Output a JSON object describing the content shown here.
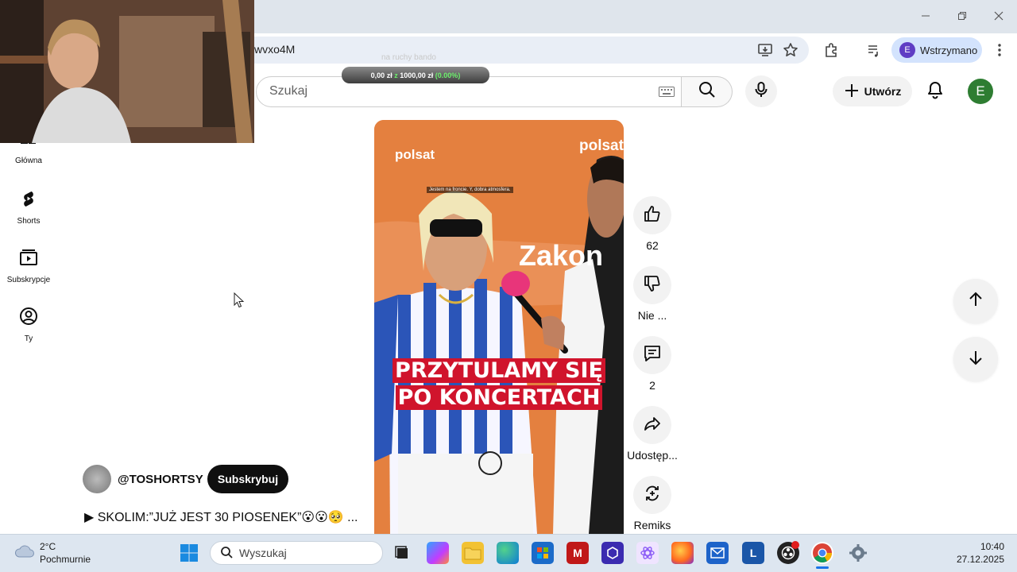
{
  "browser": {
    "url_fragment": "wvxo4M",
    "profile_initial": "E",
    "profile_status": "Wstrzymano"
  },
  "overlay": {
    "donation_label": "na ruchy bando",
    "donation_amount": "0,00 zł",
    "donation_sep": "z",
    "donation_goal": "1000,00 zł",
    "donation_percent": "(0.00%)"
  },
  "youtube": {
    "search_placeholder": "Szukaj",
    "create_label": "Utwórz",
    "avatar_initial": "E"
  },
  "sidebar": {
    "items": [
      {
        "label": "Główna",
        "icon": "home-icon"
      },
      {
        "label": "Shorts",
        "icon": "shorts-icon"
      },
      {
        "label": "Subskrypcje",
        "icon": "subscriptions-icon"
      },
      {
        "label": "Ty",
        "icon": "you-icon"
      }
    ]
  },
  "video": {
    "caption_line1": "PRZYTULAMY SIĘ",
    "caption_line2": "PO KONCERTACH",
    "subtitle_small": "Jestem na froncie. Y, dobra atmosfera.",
    "brand_left": "polsat",
    "brand_right": "polsat",
    "sign_text": "Zakon"
  },
  "actions": {
    "like_count": "62",
    "dislike_label": "Nie ...",
    "comment_count": "2",
    "share_label": "Udostęp...",
    "remix_label": "Remiks"
  },
  "channel": {
    "handle": "@TOSHORTSY",
    "subscribe_label": "Subskrybuj",
    "title": "▶ SKOLIM:”JUŻ JEST 30 PIOSENEK”😮😮🥺 ..."
  },
  "taskbar": {
    "weather_temp": "2°C",
    "weather_desc": "Pochmurnie",
    "search_placeholder": "Wyszukaj",
    "time": "10:40",
    "date": "27.12.2025"
  }
}
